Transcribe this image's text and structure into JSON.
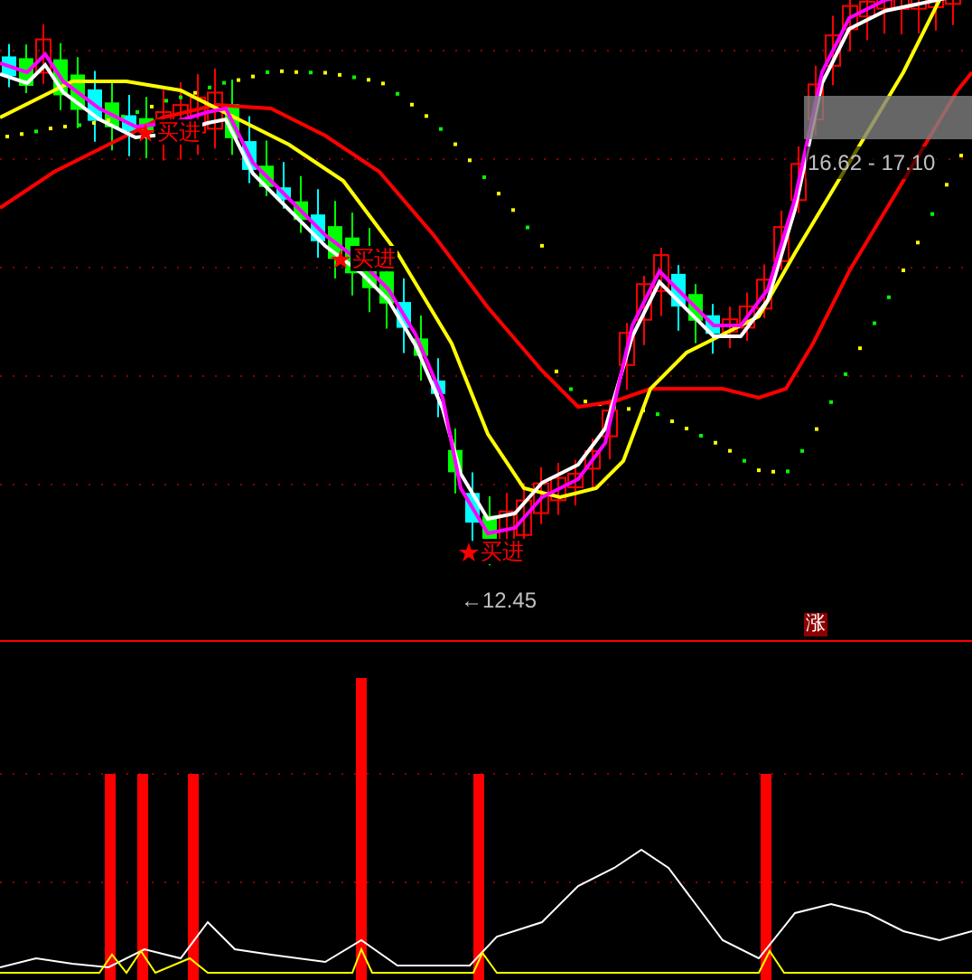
{
  "buy_signals": [
    {
      "label": "买进"
    },
    {
      "label": "买进"
    },
    {
      "label": "买进"
    }
  ],
  "low_marker": {
    "label": "←12.45"
  },
  "range_label": "16.62 - 17.10",
  "indicator_badge": "涨"
}
